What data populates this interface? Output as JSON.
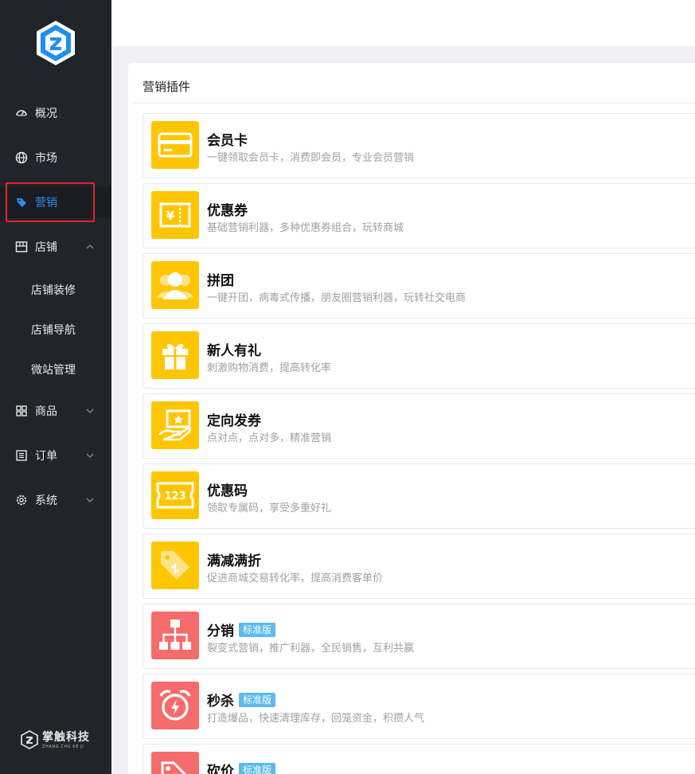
{
  "sidebar": {
    "items": [
      {
        "label": "概况",
        "icon": "dashboard-icon"
      },
      {
        "label": "市场",
        "icon": "globe-icon"
      },
      {
        "label": "营销",
        "icon": "tag-icon"
      },
      {
        "label": "店铺",
        "icon": "store-icon"
      },
      {
        "label": "商品",
        "icon": "grid-icon"
      },
      {
        "label": "订单",
        "icon": "list-icon"
      },
      {
        "label": "系统",
        "icon": "gear-icon"
      }
    ],
    "sub_items": [
      {
        "label": "店铺装修"
      },
      {
        "label": "店铺导航"
      },
      {
        "label": "微站管理"
      }
    ],
    "brand": {
      "name": "掌触科技",
      "sub": "ZHANG CHU KE JI"
    },
    "active_color": "#2d8cf0"
  },
  "main": {
    "title": "营销插件",
    "plugins": [
      {
        "name": "会员卡",
        "desc": "一键领取会员卡，消费即会员，专业会员营销",
        "icon": "membership-card-icon",
        "color": "#ffc600"
      },
      {
        "name": "优惠券",
        "desc": "基础营销利器，多种优惠券组合，玩转商城",
        "icon": "coupon-icon",
        "color": "#ffc600"
      },
      {
        "name": "拼团",
        "desc": "一键开团，病毒式传播，朋友圈营销利器，玩转社交电商",
        "icon": "group-buy-icon",
        "color": "#ffc600"
      },
      {
        "name": "新人有礼",
        "desc": "刺激购物消费，提高转化率",
        "icon": "gift-icon",
        "color": "#ffc600"
      },
      {
        "name": "定向发券",
        "desc": "点对点，点对多，精准营销",
        "icon": "directed-coupon-icon",
        "color": "#ffc600"
      },
      {
        "name": "优惠码",
        "desc": "领取专属码，享受多重好礼",
        "icon": "promo-code-icon",
        "color": "#ffc600",
        "icon_text": "123"
      },
      {
        "name": "满减满折",
        "desc": "促进商城交易转化率，提高消费客单价",
        "icon": "discount-tag-icon",
        "color": "#ffc600"
      },
      {
        "name": "分销",
        "desc": "裂变式营销，推广利器，全民销售，互利共赢",
        "icon": "distribution-icon",
        "color": "#f66b6b",
        "badge": "标准版"
      },
      {
        "name": "秒杀",
        "desc": "打造爆品，快速清理库存，回笼资金，积攒人气",
        "icon": "alarm-clock-icon",
        "color": "#f66b6b",
        "badge": "标准版"
      },
      {
        "name": "砍价",
        "desc": "",
        "icon": "bargain-icon",
        "color": "#f66b6b",
        "badge": "标准版"
      }
    ]
  }
}
